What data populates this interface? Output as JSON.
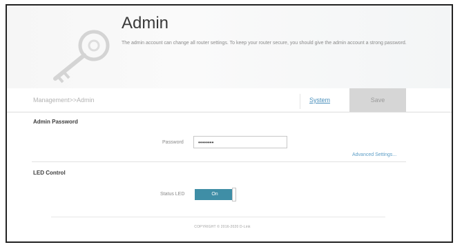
{
  "header": {
    "title": "Admin",
    "description": "The admin account can change all router settings. To keep your router secure, you should give the admin account a strong password."
  },
  "toolbar": {
    "breadcrumb": "Management>>Admin",
    "system_link": "System",
    "save_label": "Save"
  },
  "admin_password": {
    "section_title": "Admin Password",
    "password_label": "Password",
    "password_value": "••••••••",
    "advanced_link": "Advanced Settings..."
  },
  "led_control": {
    "section_title": "LED Control",
    "status_label": "Status LED",
    "toggle_label": "On"
  },
  "footer": {
    "copyright": "COPYRIGHT © 2016-2020 D-Link"
  },
  "icons": {
    "banner": "key-icon"
  },
  "colors": {
    "accent": "#3f8ea6",
    "link": "#4a8fbc",
    "save_button": "#d6d6d6"
  }
}
